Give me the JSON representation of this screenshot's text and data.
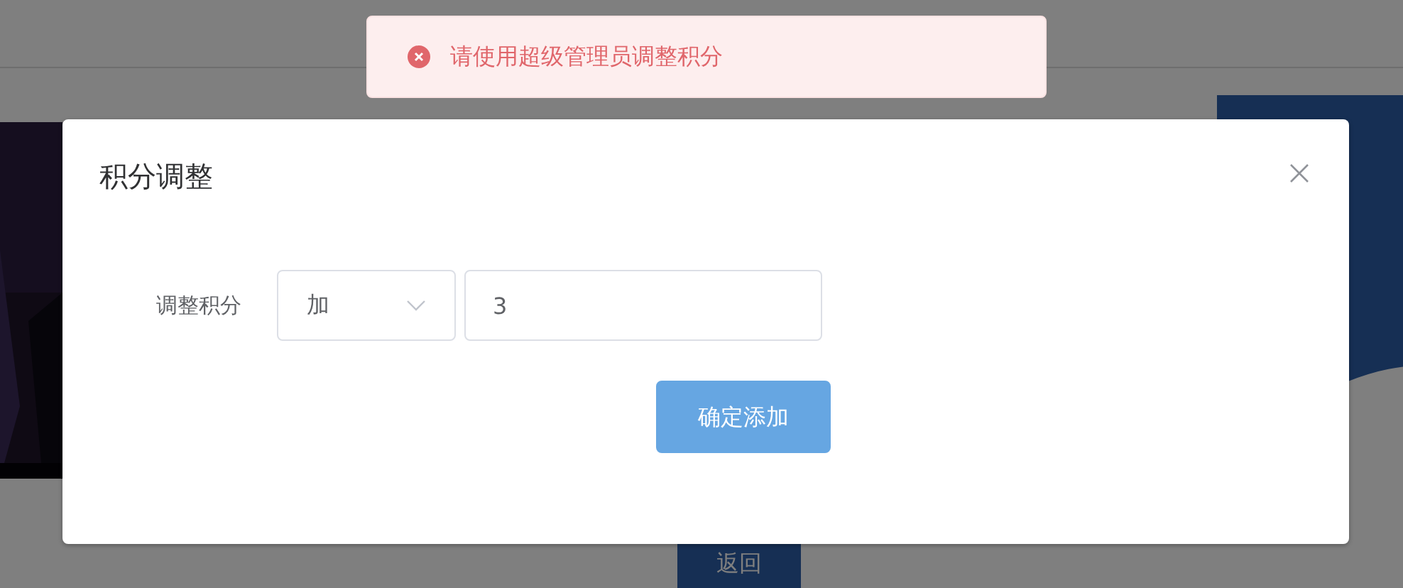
{
  "toast": {
    "kind": "error",
    "message": "请使用超级管理员调整积分"
  },
  "background": {
    "back_button": "返回"
  },
  "dialog": {
    "title": "积分调整",
    "field_label": "调整积分",
    "operation": {
      "value": "加"
    },
    "amount": {
      "value": "3"
    },
    "submit": "确定添加"
  }
}
